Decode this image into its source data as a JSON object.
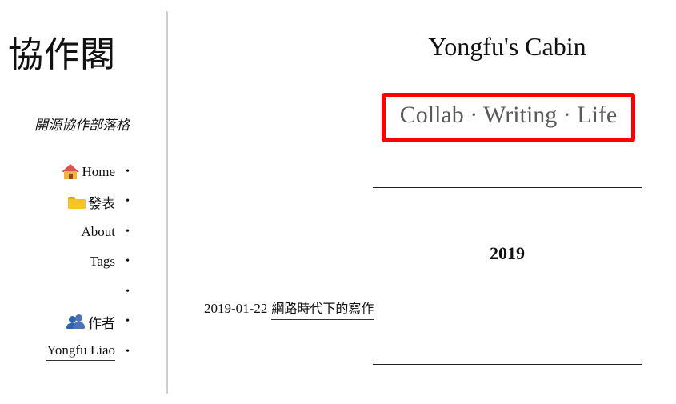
{
  "sidebar": {
    "site_title": "協作閣",
    "subtitle": "開源協作部落格",
    "bullet": "•",
    "nav": {
      "home": "Home",
      "publish": "發表",
      "about": "About",
      "tags": "Tags",
      "empty": "",
      "author": "作者",
      "person": "Yongfu Liao"
    }
  },
  "main": {
    "title": "Yongfu's Cabin",
    "tagline": "Collab · Writing · Life",
    "year": "2019",
    "posts": [
      {
        "date": "2019-01-22",
        "title": "網路時代下的寫作"
      }
    ]
  },
  "colors": {
    "highlight_box": "#ff0000",
    "divider": "#cfcfcf",
    "tagline_text": "#5a5a5a"
  },
  "icons": [
    "home-icon",
    "folder-icon",
    "people-icon"
  ]
}
